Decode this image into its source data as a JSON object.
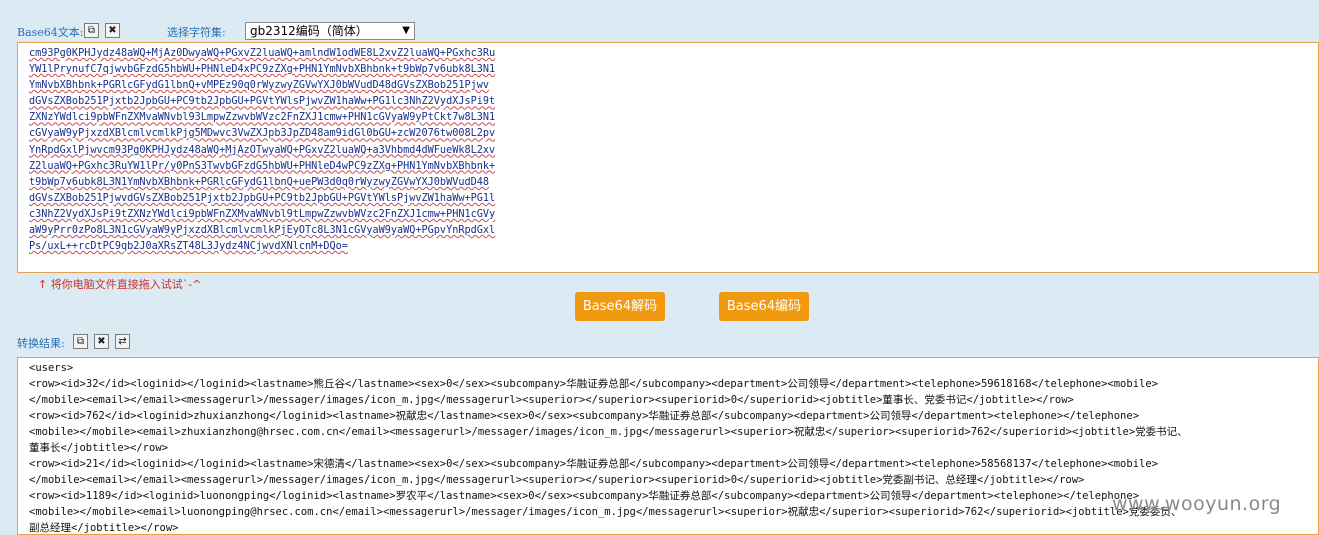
{
  "base64_label": "Base64文本:",
  "copy_icon": "⧉",
  "clear_icon": "✖",
  "swap_icon": "⇄",
  "charset_label": "选择字符集:",
  "charset_value": "gb2312编码（简体）",
  "charset_arrow": "▼",
  "base64_lines": [
    "cm93Pg0KPHJydz48aWQ+MjAz0DwyaWQ+PGxvZ2luaWQ+amlndW1odWE8L2xvZ2luaWQ+PGxhc3Ru",
    "YW1lPrynufC7qjwvbGFzdG5hbWU+PHNleD4xPC9zZXg+PHN1YmNvbXBhbnk+t9bWp7v6ubk8L3N1",
    "YmNvbXBhbnk+PGRlcGFydG1lbnQ+vMPEz90q0rWyzwyZGVwYXJ0bWVudD48dGVsZXBob251Pjwv",
    "dGVsZXBob251Pjxtb2JpbGU+PC9tb2JpbGU+PGVtYWlsPjwvZW1haWw+PG1lc3NhZ2VydXJsPi9t",
    "ZXNzYWdlci9pbWFnZXMvaWNvbl93LmpwZzwvbWVzc2FnZXJ1cmw+PHN1cGVyaW9yPtCkt7w8L3N1",
    "cGVyaW9yPjxzdXBlcmlvcmlkPjg5MDwvc3VwZXJpb3JpZD48am9idGl0bGU+zcW2076tw008L2pv",
    "YnRpdGxlPjwvcm93Pg0KPHJydz48aWQ+MjAzOTwyaWQ+PGxvZ2luaWQ+a3Vhbmd4dWFueWk8L2xv",
    "Z2luaWQ+PGxhc3RuYW1lPr/y0PnS3TwvbGFzdG5hbWU+PHNleD4wPC9zZXg+PHN1YmNvbXBhbnk+",
    "t9bWp7v6ubk8L3N1YmNvbXBhbnk+PGRlcGFydG1lbnQ+uePW3d0q0rWyzwyZGVwYXJ0bWVudD48",
    "dGVsZXBob251PjwvdGVsZXBob251Pjxtb2JpbGU+PC9tb2JpbGU+PGVtYWlsPjwvZW1haWw+PG1l",
    "c3NhZ2VydXJsPi9tZXNzYWdlci9pbWFnZXMvaWNvbl9tLmpwZzwvbWVzc2FnZXJ1cmw+PHN1cGVy",
    "aW9yPrr0zPo8L3N1cGVyaW9yPjxzdXBlcmlvcmlkPjEyOTc8L3N1cGVyaW9yaWQ+PGpvYnRpdGxl",
    "Ps/uxL++rcDtPC9qb2J0aXRsZT48L3Jydz4NCjwvdXNlcnM+DQo="
  ],
  "hint": "↑ 将你电脑文件直接拖入试试`-^",
  "decode_button": "Base64解码",
  "encode_button": "Base64编码",
  "result_label": "转换结果:",
  "result_lines": [
    "<users>",
    "<row><id>32</id><loginid></loginid><lastname>熊丘谷</lastname><sex>0</sex><subcompany>华融证券总部</subcompany><department>公司领导</department><telephone>59618168</telephone><mobile>",
    "</mobile><email></email><messagerurl>/messager/images/icon_m.jpg</messagerurl><superior></superior><superiorid>0</superiorid><jobtitle>董事长、党委书记</jobtitle></row>",
    "<row><id>762</id><loginid>zhuxianzhong</loginid><lastname>祝献忠</lastname><sex>0</sex><subcompany>华融证券总部</subcompany><department>公司领导</department><telephone></telephone>",
    "<mobile></mobile><email>zhuxianzhong@hrsec.com.cn</email><messagerurl>/messager/images/icon_m.jpg</messagerurl><superior>祝献忠</superior><superiorid>762</superiorid><jobtitle>党委书记、",
    "董事长</jobtitle></row>",
    "<row><id>21</id><loginid></loginid><lastname>宋德清</lastname><sex>0</sex><subcompany>华融证券总部</subcompany><department>公司领导</department><telephone>58568137</telephone><mobile>",
    "</mobile><email></email><messagerurl>/messager/images/icon_m.jpg</messagerurl><superior></superior><superiorid>0</superiorid><jobtitle>党委副书记、总经理</jobtitle></row>",
    "<row><id>1189</id><loginid>luonongping</loginid><lastname>罗农平</lastname><sex>0</sex><subcompany>华融证券总部</subcompany><department>公司领导</department><telephone></telephone>",
    "<mobile></mobile><email>luonongping@hrsec.com.cn</email><messagerurl>/messager/images/icon_m.jpg</messagerurl><superior>祝献忠</superior><superiorid>762</superiorid><jobtitle>党委委员、",
    "副总经理</jobtitle></row>"
  ],
  "watermark": "www.wooyun.org"
}
